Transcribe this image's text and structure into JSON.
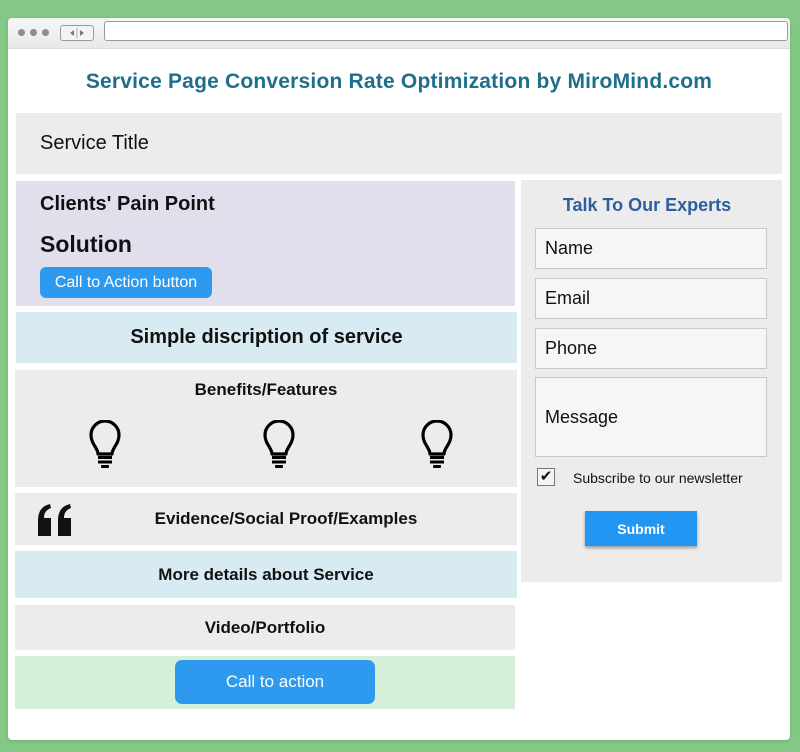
{
  "page": {
    "title": "Service Page Conversion Rate Optimization by MiroMind.com"
  },
  "service_title": "Service Title",
  "hero": {
    "pain_point": "Clients' Pain Point",
    "solution": "Solution",
    "cta_label": "Call to Action button"
  },
  "sections": {
    "description": "Simple discription of service",
    "benefits": "Benefits/Features",
    "benefit_icons": [
      "lightbulb-icon",
      "lightbulb-icon",
      "lightbulb-icon"
    ],
    "evidence": "Evidence/Social Proof/Examples",
    "evidence_icon": "quote-icon",
    "more_details": "More details about Service",
    "video": "Video/Portfolio",
    "cta_label": "Call to action"
  },
  "form": {
    "heading": "Talk To Our Experts",
    "name_placeholder": "Name",
    "email_placeholder": "Email",
    "phone_placeholder": "Phone",
    "message_placeholder": "Message",
    "subscribe_checked": true,
    "subscribe_label": "Subscribe to our newsletter",
    "submit_label": "Submit"
  },
  "colors": {
    "background": "#84c886",
    "title": "#1f6f8b",
    "form_heading": "#2f5e9e",
    "button": "#2196f3",
    "panel_gray": "#ececec",
    "panel_lavender": "#e2dfec",
    "panel_light_blue": "#d8ebf2",
    "panel_light_green": "#d6efd8"
  }
}
